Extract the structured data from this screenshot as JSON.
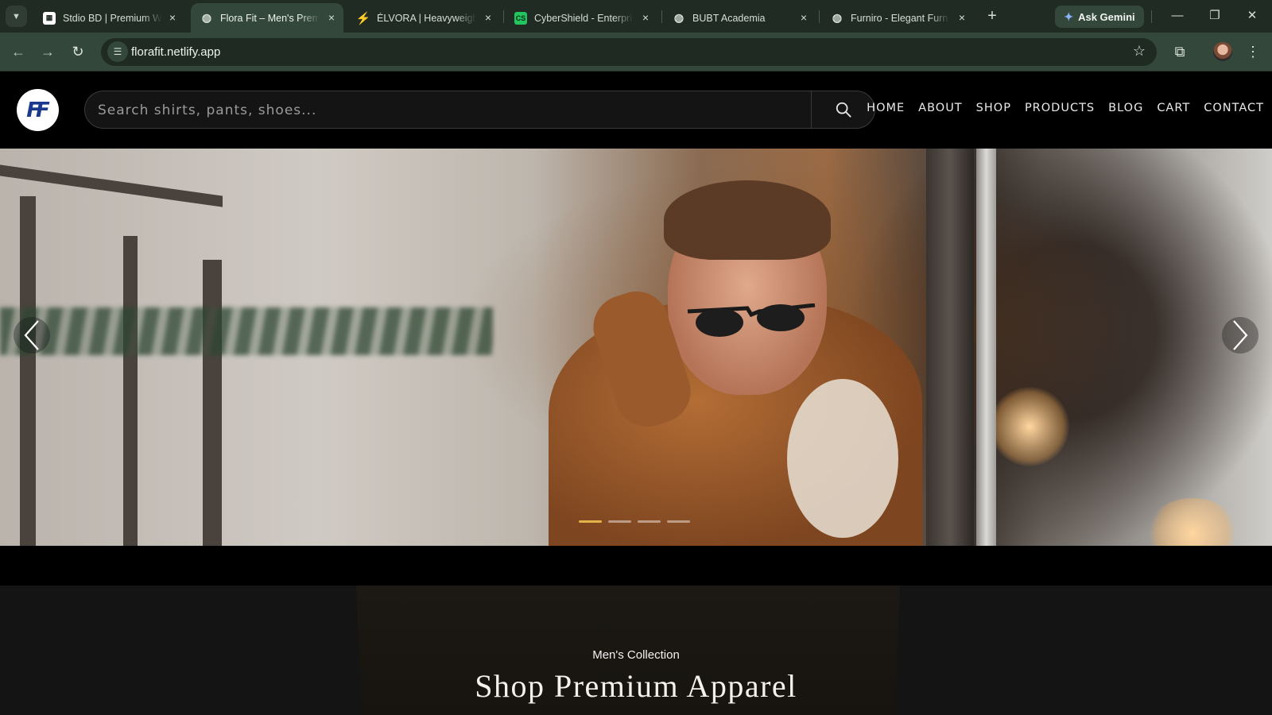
{
  "browser": {
    "tabs": [
      {
        "title": "Stdio BD | Premium W",
        "active": false
      },
      {
        "title": "Flora Fit – Men's Prem",
        "active": true
      },
      {
        "title": "ÉLVORA | Heavyweight",
        "active": false
      },
      {
        "title": "CyberShield - Enterpris",
        "active": false
      },
      {
        "title": "BUBT Academia",
        "active": false
      },
      {
        "title": "Furniro - Elegant Furn",
        "active": false
      }
    ],
    "ask_gemini": "Ask Gemini",
    "url": "florafit.netlify.app",
    "colors": {
      "frame": "#1f2b23",
      "toolbar": "#33473a"
    }
  },
  "site": {
    "logo_text": "FF",
    "search_placeholder": "Search shirts, pants, shoes...",
    "nav": [
      "HOME",
      "ABOUT",
      "SHOP",
      "PRODUCTS",
      "BLOG",
      "CART",
      "CONTACT"
    ],
    "slider": {
      "slides": 4,
      "active_index": 0,
      "accent": "#e3b34a"
    },
    "collection": {
      "eyebrow": "Men's Collection",
      "heading": "Shop Premium Apparel"
    }
  }
}
